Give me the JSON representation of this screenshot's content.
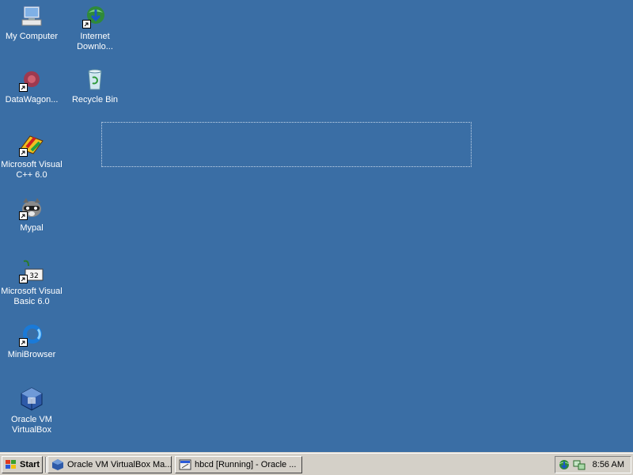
{
  "desktop": {
    "background_color": "#3a6ea5",
    "icons": [
      {
        "label": "My Computer",
        "icon": "my-computer-icon",
        "shortcut": false
      },
      {
        "label": "Internet Downlo...",
        "icon": "internet-download-manager-icon",
        "shortcut": true
      },
      {
        "label": "DataWagon...",
        "icon": "datawagon-icon",
        "shortcut": true
      },
      {
        "label": "Recycle Bin",
        "icon": "recycle-bin-icon",
        "shortcut": false
      },
      {
        "label": "Microsoft Visual C++ 6.0",
        "icon": "visual-cpp-icon",
        "shortcut": true
      },
      {
        "label": "Mypal",
        "icon": "mypal-raccoon-icon",
        "shortcut": true
      },
      {
        "label": "Microsoft Visual Basic 6.0",
        "icon": "visual-basic-icon",
        "shortcut": true
      },
      {
        "label": "MiniBrowser",
        "icon": "minibrowser-icon",
        "shortcut": true
      },
      {
        "label": "Oracle VM VirtualBox",
        "icon": "virtualbox-icon",
        "shortcut": false
      }
    ]
  },
  "taskbar": {
    "start_label": "Start",
    "buttons": [
      {
        "label": "Oracle VM VirtualBox Ma...",
        "icon": "virtualbox-icon"
      },
      {
        "label": "hbcd [Running] - Oracle ...",
        "icon": "virtualbox-vm-icon"
      }
    ],
    "tray": {
      "icons": [
        "network-globe-icon",
        "network-connection-icon"
      ],
      "clock": "8:56 AM"
    }
  }
}
